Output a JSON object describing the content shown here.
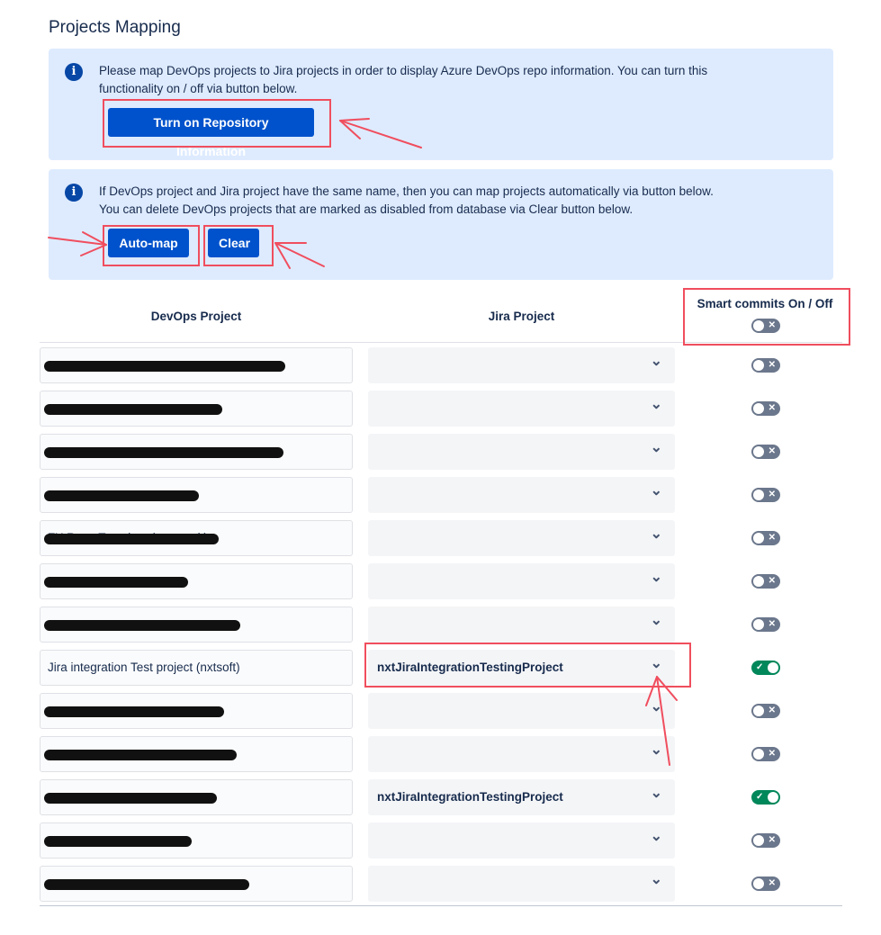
{
  "page": {
    "title": "Projects Mapping"
  },
  "info_repo": {
    "icon": "info-icon",
    "line1": "Please map DevOps projects to Jira projects in order to display Azure DevOps repo information. You can turn this",
    "line2": "functionality on / off via button below.",
    "button_label": "Turn on Repository Information"
  },
  "info_auto": {
    "icon": "info-icon",
    "line1": "If DevOps project and Jira project have the same name, then you can map projects automatically via button below.",
    "line2": "You can delete DevOps projects that are marked as disabled from database via Clear button below.",
    "automap_label": "Auto-map",
    "clear_label": "Clear"
  },
  "table": {
    "headers": {
      "devops": "DevOps Project",
      "jira": "Jira Project",
      "smart": "Smart commits On / Off"
    },
    "header_toggle": "off",
    "rows": [
      {
        "devops": "",
        "redacted": true,
        "jira": "",
        "smart": "off"
      },
      {
        "devops": "",
        "redacted": true,
        "jira": "",
        "smart": "off"
      },
      {
        "devops": "",
        "redacted": true,
        "jira": "",
        "smart": "off"
      },
      {
        "devops": "",
        "redacted": true,
        "jira": "",
        "smart": "off"
      },
      {
        "devops": "FX.ReactTemplate (notovosk)",
        "redacted": true,
        "jira": "",
        "smart": "off"
      },
      {
        "devops": "",
        "redacted": true,
        "jira": "",
        "smart": "off"
      },
      {
        "devops": "",
        "redacted": true,
        "jira": "",
        "smart": "off"
      },
      {
        "devops": "Jira integration Test project (nxtsoft)",
        "redacted": false,
        "jira": "nxtJiraIntegrationTestingProject",
        "smart": "on"
      },
      {
        "devops": "",
        "redacted": true,
        "jira": "",
        "smart": "off"
      },
      {
        "devops": "",
        "redacted": true,
        "jira": "",
        "smart": "off"
      },
      {
        "devops": "",
        "redacted": true,
        "jira": "nxtJiraIntegrationTestingProject",
        "smart": "on"
      },
      {
        "devops": "",
        "redacted": true,
        "jira": "",
        "smart": "off"
      },
      {
        "devops": "",
        "redacted": true,
        "jira": "",
        "smart": "off"
      }
    ]
  },
  "colors": {
    "primary": "#0052cc",
    "info_bg": "#deebff",
    "toggle_on": "#00875a",
    "toggle_off": "#6b778c",
    "annotation": "#f04e5e"
  }
}
